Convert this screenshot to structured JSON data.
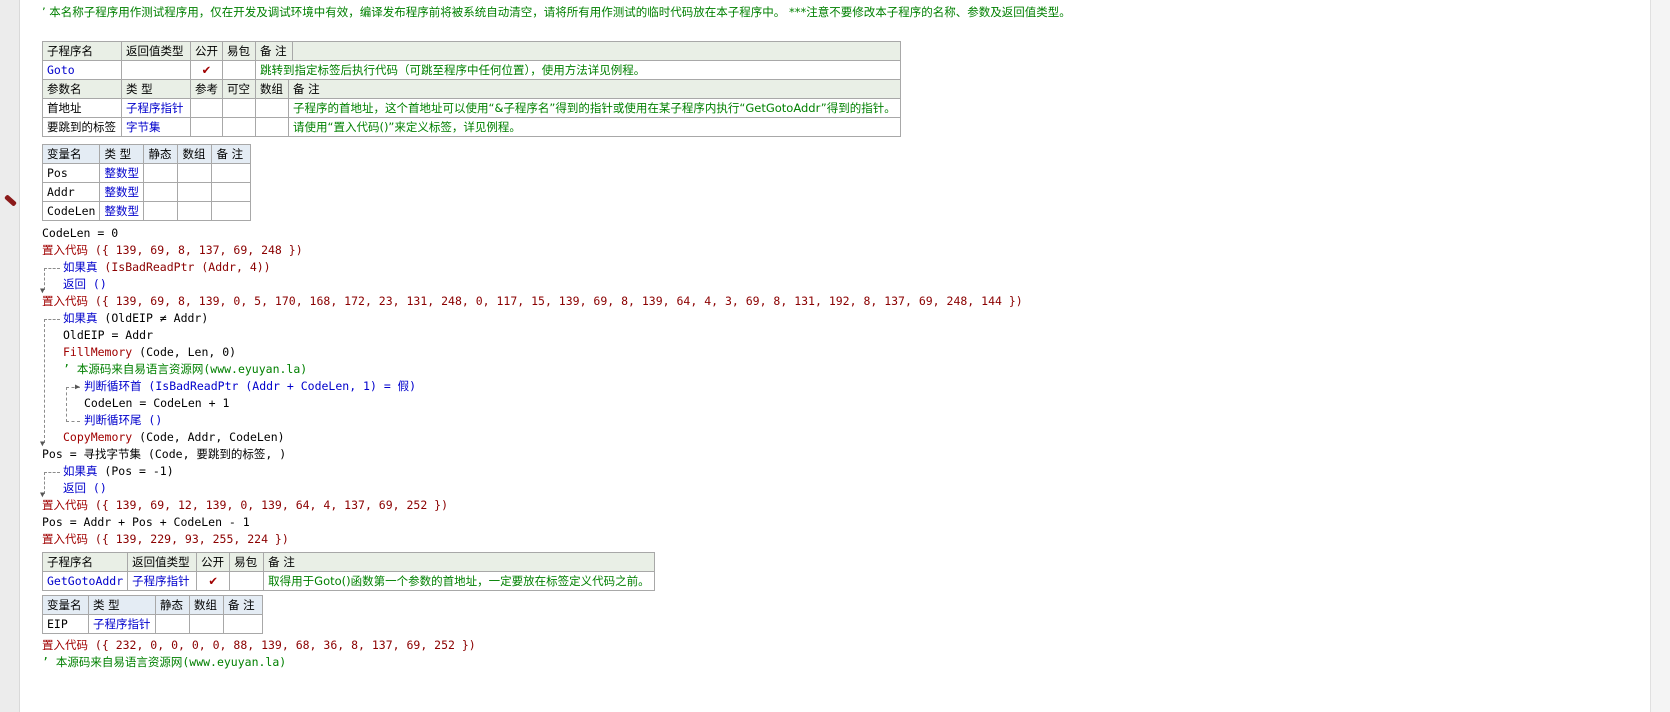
{
  "header_comment": "’ 本名称子程序用作测试程序用，仅在开发及调试环境中有效，编译发布程序前将被系统自动清空，请将所有用作测试的临时代码放在本子程序中。 ***注意不要修改本子程序的名称、参数及返回值类型。",
  "table1": {
    "headers": [
      "子程序名",
      "返回值类型",
      "公开",
      "易包",
      "备 注"
    ],
    "name": "Goto",
    "return_type": "",
    "public_mark": "✔",
    "remark": "跳转到指定标签后执行代码（可跳至程序中任何位置），使用方法详见例程。",
    "param_headers": [
      "参数名",
      "类 型",
      "参考",
      "可空",
      "数组",
      "备 注"
    ],
    "params": [
      {
        "name": "首地址",
        "type": "子程序指针",
        "remark": "子程序的首地址，这个首地址可以使用“&子程序名”得到的指针或使用在某子程序内执行“GetGotoAddr”得到的指针。"
      },
      {
        "name": "要跳到的标签",
        "type": "字节集",
        "remark": "请使用“置入代码()”来定义标签，详见例程。"
      }
    ]
  },
  "vars1": {
    "headers": [
      "变量名",
      "类 型",
      "静态",
      "数组",
      "备 注"
    ],
    "rows": [
      {
        "name": "Pos",
        "type": "整数型"
      },
      {
        "name": "Addr",
        "type": "整数型"
      },
      {
        "name": "CodeLen",
        "type": "整数型"
      }
    ]
  },
  "code1": [
    {
      "t": "CodeLen = 0"
    },
    {
      "kw": "置入代码",
      "t": " ({ 139, 69, 8, 137, 69, 248 })"
    },
    {
      "kw": "如果真",
      "t": " (IsBadReadPtr (Addr, 4))"
    },
    {
      "kw": "返回",
      "t": " ()"
    },
    {
      "kw": "置入代码",
      "t": " ({ 139, 69, 8, 139, 0, 5, 170, 168, 172, 23, 131, 248, 0, 117, 15, 139, 69, 8, 139, 64, 4, 3, 69, 8, 131, 192, 8, 137, 69, 248, 144 })"
    },
    {
      "kw": "如果真",
      "t": " (OldEIP ≠ Addr)"
    },
    {
      "t": "OldEIP = Addr"
    },
    {
      "kw": "FillMemory",
      "t": " (Code, Len, 0)"
    },
    {
      "t": "’ 本源码来自易语言资源网(www.eyuyan.la)"
    },
    {
      "kw": "判断循环首",
      "t": " (IsBadReadPtr (Addr + CodeLen, 1) = 假)"
    },
    {
      "t": "CodeLen = CodeLen + 1"
    },
    {
      "kw": "判断循环尾",
      "t": " ()"
    },
    {
      "kw": "CopyMemory",
      "t": " (Code, Addr, CodeLen)"
    },
    {
      "t": "Pos = 寻找字节集 (Code, 要跳到的标签, )"
    },
    {
      "kw": "如果真",
      "t": " (Pos = -1)"
    },
    {
      "kw": "返回",
      "t": " ()"
    },
    {
      "kw": "置入代码",
      "t": " ({ 139, 69, 12, 139, 0, 139, 64, 4, 137, 69, 252 })"
    },
    {
      "t": "Pos = Addr + Pos + CodeLen - 1"
    },
    {
      "kw": "置入代码",
      "t": " ({ 139, 229, 93, 255, 224 })"
    }
  ],
  "table2": {
    "headers": [
      "子程序名",
      "返回值类型",
      "公开",
      "易包",
      "备 注"
    ],
    "name": "GetGotoAddr",
    "return_type": "子程序指针",
    "public_mark": "✔",
    "remark": "取得用于Goto()函数第一个参数的首地址，一定要放在标签定义代码之前。"
  },
  "vars2": {
    "headers": [
      "变量名",
      "类 型",
      "静态",
      "数组",
      "备 注"
    ],
    "rows": [
      {
        "name": "EIP",
        "type": "子程序指针"
      }
    ]
  },
  "code2": [
    {
      "kw": "置入代码",
      "t": " ({ 232, 0, 0, 0, 0, 88, 139, 68, 36, 8, 137, 69, 252 })"
    },
    {
      "t": "’ 本源码来自易语言资源网(www.eyuyan.la)"
    }
  ]
}
